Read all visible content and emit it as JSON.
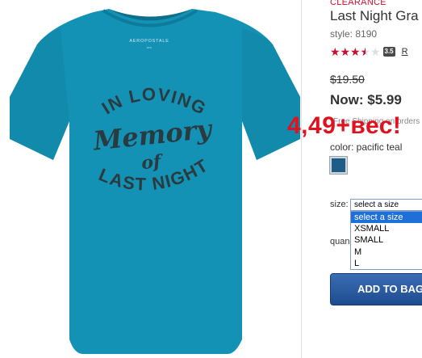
{
  "product": {
    "clearance_label": "CLEARANCE",
    "title": "Last Night Gra",
    "style": "style: 8190",
    "rating": 3.5,
    "rating_max": 5,
    "rating_badge": "3.5",
    "reviews_link": "R",
    "old_price": "$19.50",
    "now_price": "Now: $5.99",
    "shipping_text": "Free Shipping on orders of",
    "overlay_price": "4,49+вес!",
    "color_label": "color: pacific teal",
    "swatch_color": "#1e5d88",
    "size_label": "size:",
    "size_selected": "select a size",
    "size_options": [
      "select a size",
      "XSMALL",
      "SMALL",
      "M",
      "L"
    ],
    "quantity_label": "quantity",
    "add_to_bag": "ADD TO BAG"
  },
  "image": {
    "brand": "AEROPOSTALE",
    "shirt_color": "#1492b5",
    "print_lines": [
      "IN LOVING",
      "Memory",
      "of",
      "LAST NIGHT"
    ]
  }
}
